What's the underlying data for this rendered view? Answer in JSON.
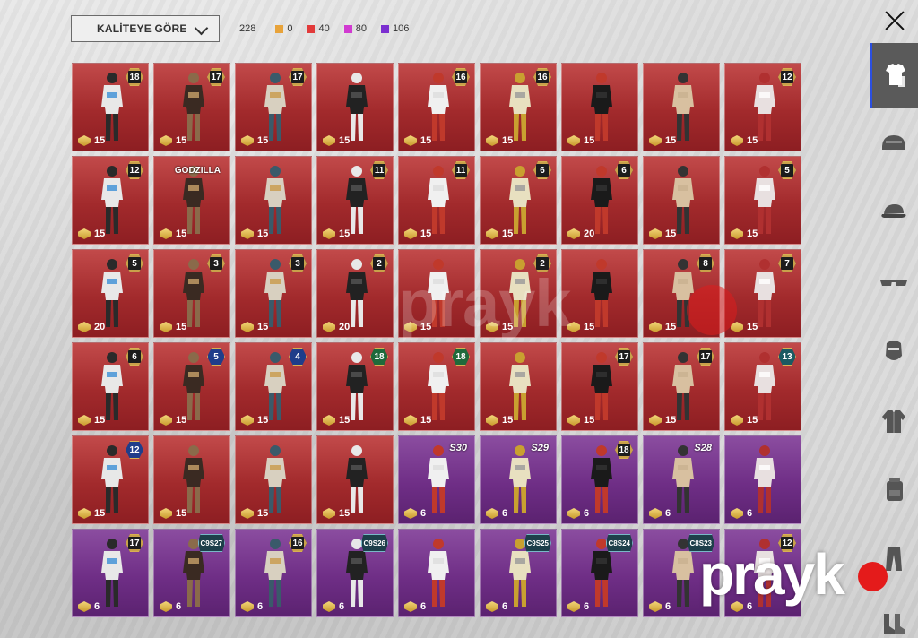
{
  "toolbar": {
    "sort_label": "KALİTEYE GÖRE",
    "total_count": "228",
    "counts": [
      {
        "value": "0",
        "color": "#e8a33a"
      },
      {
        "value": "40",
        "color": "#e23a3a"
      },
      {
        "value": "80",
        "color": "#d13ad1"
      },
      {
        "value": "106",
        "color": "#7b2fd0"
      }
    ]
  },
  "sidebar": {
    "categories": [
      {
        "icon": "outfit-icon",
        "active": true
      },
      {
        "icon": "helmet-icon",
        "active": false
      },
      {
        "icon": "cap-icon",
        "active": false
      },
      {
        "icon": "glasses-icon",
        "active": false
      },
      {
        "icon": "mask-icon",
        "active": false
      },
      {
        "icon": "jacket-icon",
        "active": false
      },
      {
        "icon": "backpack-icon",
        "active": false
      },
      {
        "icon": "pants-icon",
        "active": false
      },
      {
        "icon": "shoes-icon",
        "active": false
      }
    ]
  },
  "grid": {
    "items": [
      {
        "rarity": "red",
        "price": "15",
        "badge": "18",
        "badge_style": "hex"
      },
      {
        "rarity": "red",
        "price": "15",
        "badge": "17",
        "badge_style": "hex"
      },
      {
        "rarity": "red",
        "price": "15",
        "badge": "17",
        "badge_style": "hex"
      },
      {
        "rarity": "red",
        "price": "15",
        "badge": "",
        "badge_style": ""
      },
      {
        "rarity": "red",
        "price": "15",
        "badge": "16",
        "badge_style": "hex"
      },
      {
        "rarity": "red",
        "price": "15",
        "badge": "16",
        "badge_style": "hex"
      },
      {
        "rarity": "red",
        "price": "15",
        "badge": "",
        "badge_style": ""
      },
      {
        "rarity": "red",
        "price": "15",
        "badge": "",
        "badge_style": ""
      },
      {
        "rarity": "red",
        "price": "15",
        "badge": "12",
        "badge_style": "hex"
      },
      {
        "rarity": "red",
        "price": "15",
        "badge": "12",
        "badge_style": "hex"
      },
      {
        "rarity": "red",
        "price": "15",
        "badge": "GODZILLA",
        "badge_style": "text"
      },
      {
        "rarity": "red",
        "price": "15",
        "badge": "",
        "badge_style": ""
      },
      {
        "rarity": "red",
        "price": "15",
        "badge": "11",
        "badge_style": "hex"
      },
      {
        "rarity": "red",
        "price": "15",
        "badge": "11",
        "badge_style": "hex"
      },
      {
        "rarity": "red",
        "price": "15",
        "badge": "6",
        "badge_style": "hex"
      },
      {
        "rarity": "red",
        "price": "20",
        "badge": "6",
        "badge_style": "hex"
      },
      {
        "rarity": "red",
        "price": "15",
        "badge": "",
        "badge_style": ""
      },
      {
        "rarity": "red",
        "price": "15",
        "badge": "5",
        "badge_style": "hex"
      },
      {
        "rarity": "red",
        "price": "20",
        "badge": "5",
        "badge_style": "hex"
      },
      {
        "rarity": "red",
        "price": "15",
        "badge": "3",
        "badge_style": "hex"
      },
      {
        "rarity": "red",
        "price": "15",
        "badge": "3",
        "badge_style": "hex"
      },
      {
        "rarity": "red",
        "price": "20",
        "badge": "2",
        "badge_style": "hex"
      },
      {
        "rarity": "red",
        "price": "15",
        "badge": "",
        "badge_style": ""
      },
      {
        "rarity": "red",
        "price": "15",
        "badge": "2",
        "badge_style": "hex"
      },
      {
        "rarity": "red",
        "price": "15",
        "badge": "",
        "badge_style": ""
      },
      {
        "rarity": "red",
        "price": "15",
        "badge": "8",
        "badge_style": "hex"
      },
      {
        "rarity": "red",
        "price": "15",
        "badge": "7",
        "badge_style": "hex"
      },
      {
        "rarity": "red",
        "price": "15",
        "badge": "6",
        "badge_style": "hex"
      },
      {
        "rarity": "red",
        "price": "15",
        "badge": "5",
        "badge_style": "blue"
      },
      {
        "rarity": "red",
        "price": "15",
        "badge": "4",
        "badge_style": "blue"
      },
      {
        "rarity": "red",
        "price": "15",
        "badge": "18",
        "badge_style": "green"
      },
      {
        "rarity": "red",
        "price": "15",
        "badge": "18",
        "badge_style": "green"
      },
      {
        "rarity": "red",
        "price": "15",
        "badge": "",
        "badge_style": ""
      },
      {
        "rarity": "red",
        "price": "15",
        "badge": "17",
        "badge_style": "hex"
      },
      {
        "rarity": "red",
        "price": "15",
        "badge": "17",
        "badge_style": "hex"
      },
      {
        "rarity": "red",
        "price": "15",
        "badge": "13",
        "badge_style": "teal"
      },
      {
        "rarity": "red",
        "price": "15",
        "badge": "12",
        "badge_style": "blue"
      },
      {
        "rarity": "red",
        "price": "15",
        "badge": "",
        "badge_style": ""
      },
      {
        "rarity": "red",
        "price": "15",
        "badge": "",
        "badge_style": ""
      },
      {
        "rarity": "red",
        "price": "15",
        "badge": "",
        "badge_style": ""
      },
      {
        "rarity": "purple",
        "price": "6",
        "badge": "S30",
        "badge_style": "s"
      },
      {
        "rarity": "purple",
        "price": "6",
        "badge": "S29",
        "badge_style": "s"
      },
      {
        "rarity": "purple",
        "price": "6",
        "badge": "18",
        "badge_style": "hex"
      },
      {
        "rarity": "purple",
        "price": "6",
        "badge": "S28",
        "badge_style": "s"
      },
      {
        "rarity": "purple",
        "price": "6",
        "badge": "",
        "badge_style": ""
      },
      {
        "rarity": "purple",
        "price": "6",
        "badge": "17",
        "badge_style": "hex"
      },
      {
        "rarity": "purple",
        "price": "6",
        "badge": "C9S27",
        "badge_style": "tag"
      },
      {
        "rarity": "purple",
        "price": "6",
        "badge": "16",
        "badge_style": "hex"
      },
      {
        "rarity": "purple",
        "price": "6",
        "badge": "C9S26",
        "badge_style": "tag"
      },
      {
        "rarity": "purple",
        "price": "6",
        "badge": "",
        "badge_style": ""
      },
      {
        "rarity": "purple",
        "price": "6",
        "badge": "C9S25",
        "badge_style": "tag"
      },
      {
        "rarity": "purple",
        "price": "6",
        "badge": "C8S24",
        "badge_style": "tag"
      },
      {
        "rarity": "purple",
        "price": "6",
        "badge": "C8S23",
        "badge_style": "tag"
      },
      {
        "rarity": "purple",
        "price": "6",
        "badge": "12",
        "badge_style": "hex"
      }
    ]
  },
  "watermark": {
    "center_text": "prayk",
    "brand_text": "prayk"
  }
}
